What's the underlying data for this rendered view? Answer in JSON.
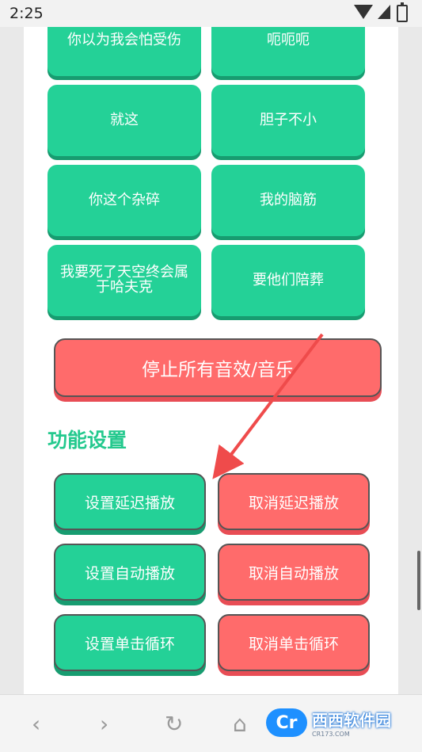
{
  "status_bar": {
    "time": "2:25"
  },
  "sound_grid": [
    "你以为我会怕受伤",
    "呃呃呃",
    "就这",
    "胆子不小",
    "你这个杂碎",
    "我的脑筋",
    "我要死了天空终会属于哈夫克",
    "要他们陪葬"
  ],
  "stop_button": "停止所有音效/音乐",
  "settings": {
    "title": "功能设置",
    "buttons": [
      {
        "set": "设置延迟播放",
        "cancel": "取消延迟播放"
      },
      {
        "set": "设置自动播放",
        "cancel": "取消自动播放"
      },
      {
        "set": "设置单击循环",
        "cancel": "取消单击循环"
      }
    ]
  },
  "browser_nav": {
    "back": "back-icon",
    "forward": "forward-icon",
    "refresh": "refresh-icon",
    "home": "home-icon"
  },
  "watermark": {
    "logo": "Cr",
    "main": "西西软件园",
    "sub": "CR173.COM"
  },
  "colors": {
    "green": "#24d197",
    "red": "#ff6b6b",
    "title_green": "#24c98e"
  }
}
